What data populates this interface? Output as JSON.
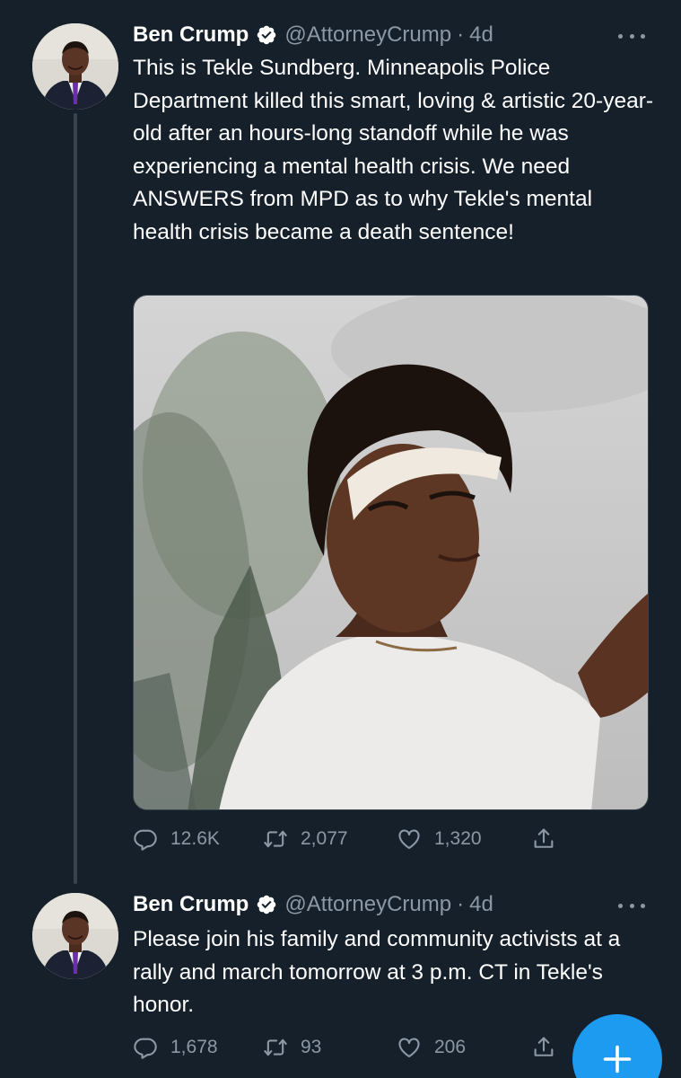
{
  "tweets": [
    {
      "author": {
        "name": "Ben Crump",
        "handle": "@AttorneyCrump",
        "avatar_icon": "profile-photo"
      },
      "separator": "·",
      "time": "4d",
      "text": "This is Tekle Sundberg. Minneapolis Police Department killed this smart, loving & artistic 20-year-old after an hours-long standoff while he was experiencing a mental health crisis. We need ANSWERS from MPD as to why Tekle's mental health crisis became a death sentence!",
      "media": {
        "type": "photo",
        "icon": "photo-young-man-with-bandana"
      },
      "stats": {
        "replies": "12.6K",
        "retweets": "2,077",
        "likes": "1,320"
      }
    },
    {
      "author": {
        "name": "Ben Crump",
        "handle": "@AttorneyCrump",
        "avatar_icon": "profile-photo"
      },
      "separator": "·",
      "time": "4d",
      "text": "Please join his family and community activists at a rally and march tomorrow at 3 p.m. CT in Tekle's honor.",
      "stats": {
        "replies": "1,678",
        "retweets": "93",
        "likes": "206"
      }
    }
  ],
  "icons": {
    "reply": "reply-icon",
    "retweet": "retweet-icon",
    "like": "heart-icon",
    "share": "share-icon",
    "more": "more-icon",
    "verified": "verified-badge-icon",
    "compose": "plus-icon"
  },
  "colors": {
    "background": "#15202b",
    "text_primary": "#ffffff",
    "text_secondary": "#8b98a5",
    "thread_line": "#38444d",
    "accent": "#1d9bf0"
  }
}
